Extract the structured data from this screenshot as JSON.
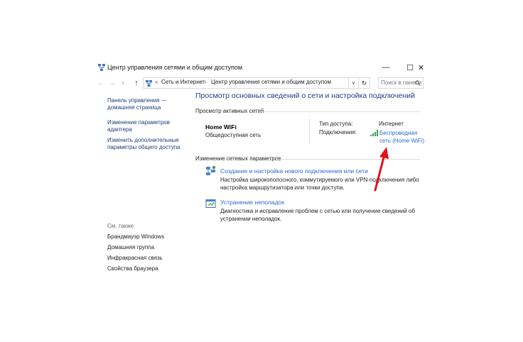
{
  "window": {
    "title": "Центр управления сетями и общим доступом",
    "controls": {
      "minimize": "—",
      "maximize": "☐",
      "close": "✕"
    }
  },
  "nav": {
    "back": "←",
    "forward": "→",
    "recent": "∨",
    "up": "↑",
    "breadcrumb_sep": "«",
    "breadcrumb": [
      "Сеть и Интернет",
      "Центр управления сетями и общим доступом"
    ],
    "breadcrumb_arrow": "›",
    "dropdown": "∨",
    "refresh": "↻",
    "search_placeholder": "Поиск в панели"
  },
  "sidebar": {
    "home_link": [
      "Панель управления —",
      "домашняя страница"
    ],
    "adapter_link": [
      "Изменение параметров",
      "адаптера"
    ],
    "sharing_link": [
      "Изменить дополнительные",
      "параметры общего доступа"
    ],
    "see_also": "См. также",
    "see_also_items": [
      "Брандмауэр Windows",
      "Домашняя группа",
      "Инфракрасная связь",
      "Свойства браузера"
    ]
  },
  "main": {
    "title": "Просмотр основных сведений о сети и настройка подключений",
    "active_networks_heading": "Просмотр активных сетей",
    "network": {
      "name": "Home WiFi",
      "category": "Общедоступная сеть",
      "access_type_label": "Тип доступа:",
      "access_type_value": "Интернет",
      "connections_label": "Подключения:",
      "connection_link": [
        "Беспроводная",
        "сеть (Home WiFi)"
      ]
    },
    "change_settings_heading": "Изменение сетевых параметров",
    "tasks": [
      {
        "link": "Создание и настройка нового подключения или сети",
        "desc": [
          "Настройка широкополосного, коммутируемого или VPN-подключения либо",
          "настройка маршрутизатора или точки доступа."
        ],
        "icon": "network-setup-icon"
      },
      {
        "link": "Устранение неполадок",
        "desc": [
          "Диагностика и исправление проблем с сетью или получение сведений об",
          "устранении неполадок."
        ],
        "icon": "troubleshoot-icon"
      }
    ]
  },
  "colors": {
    "link": "#2a6bc8",
    "title": "#1e3f86",
    "arrow": "#e3121e"
  }
}
